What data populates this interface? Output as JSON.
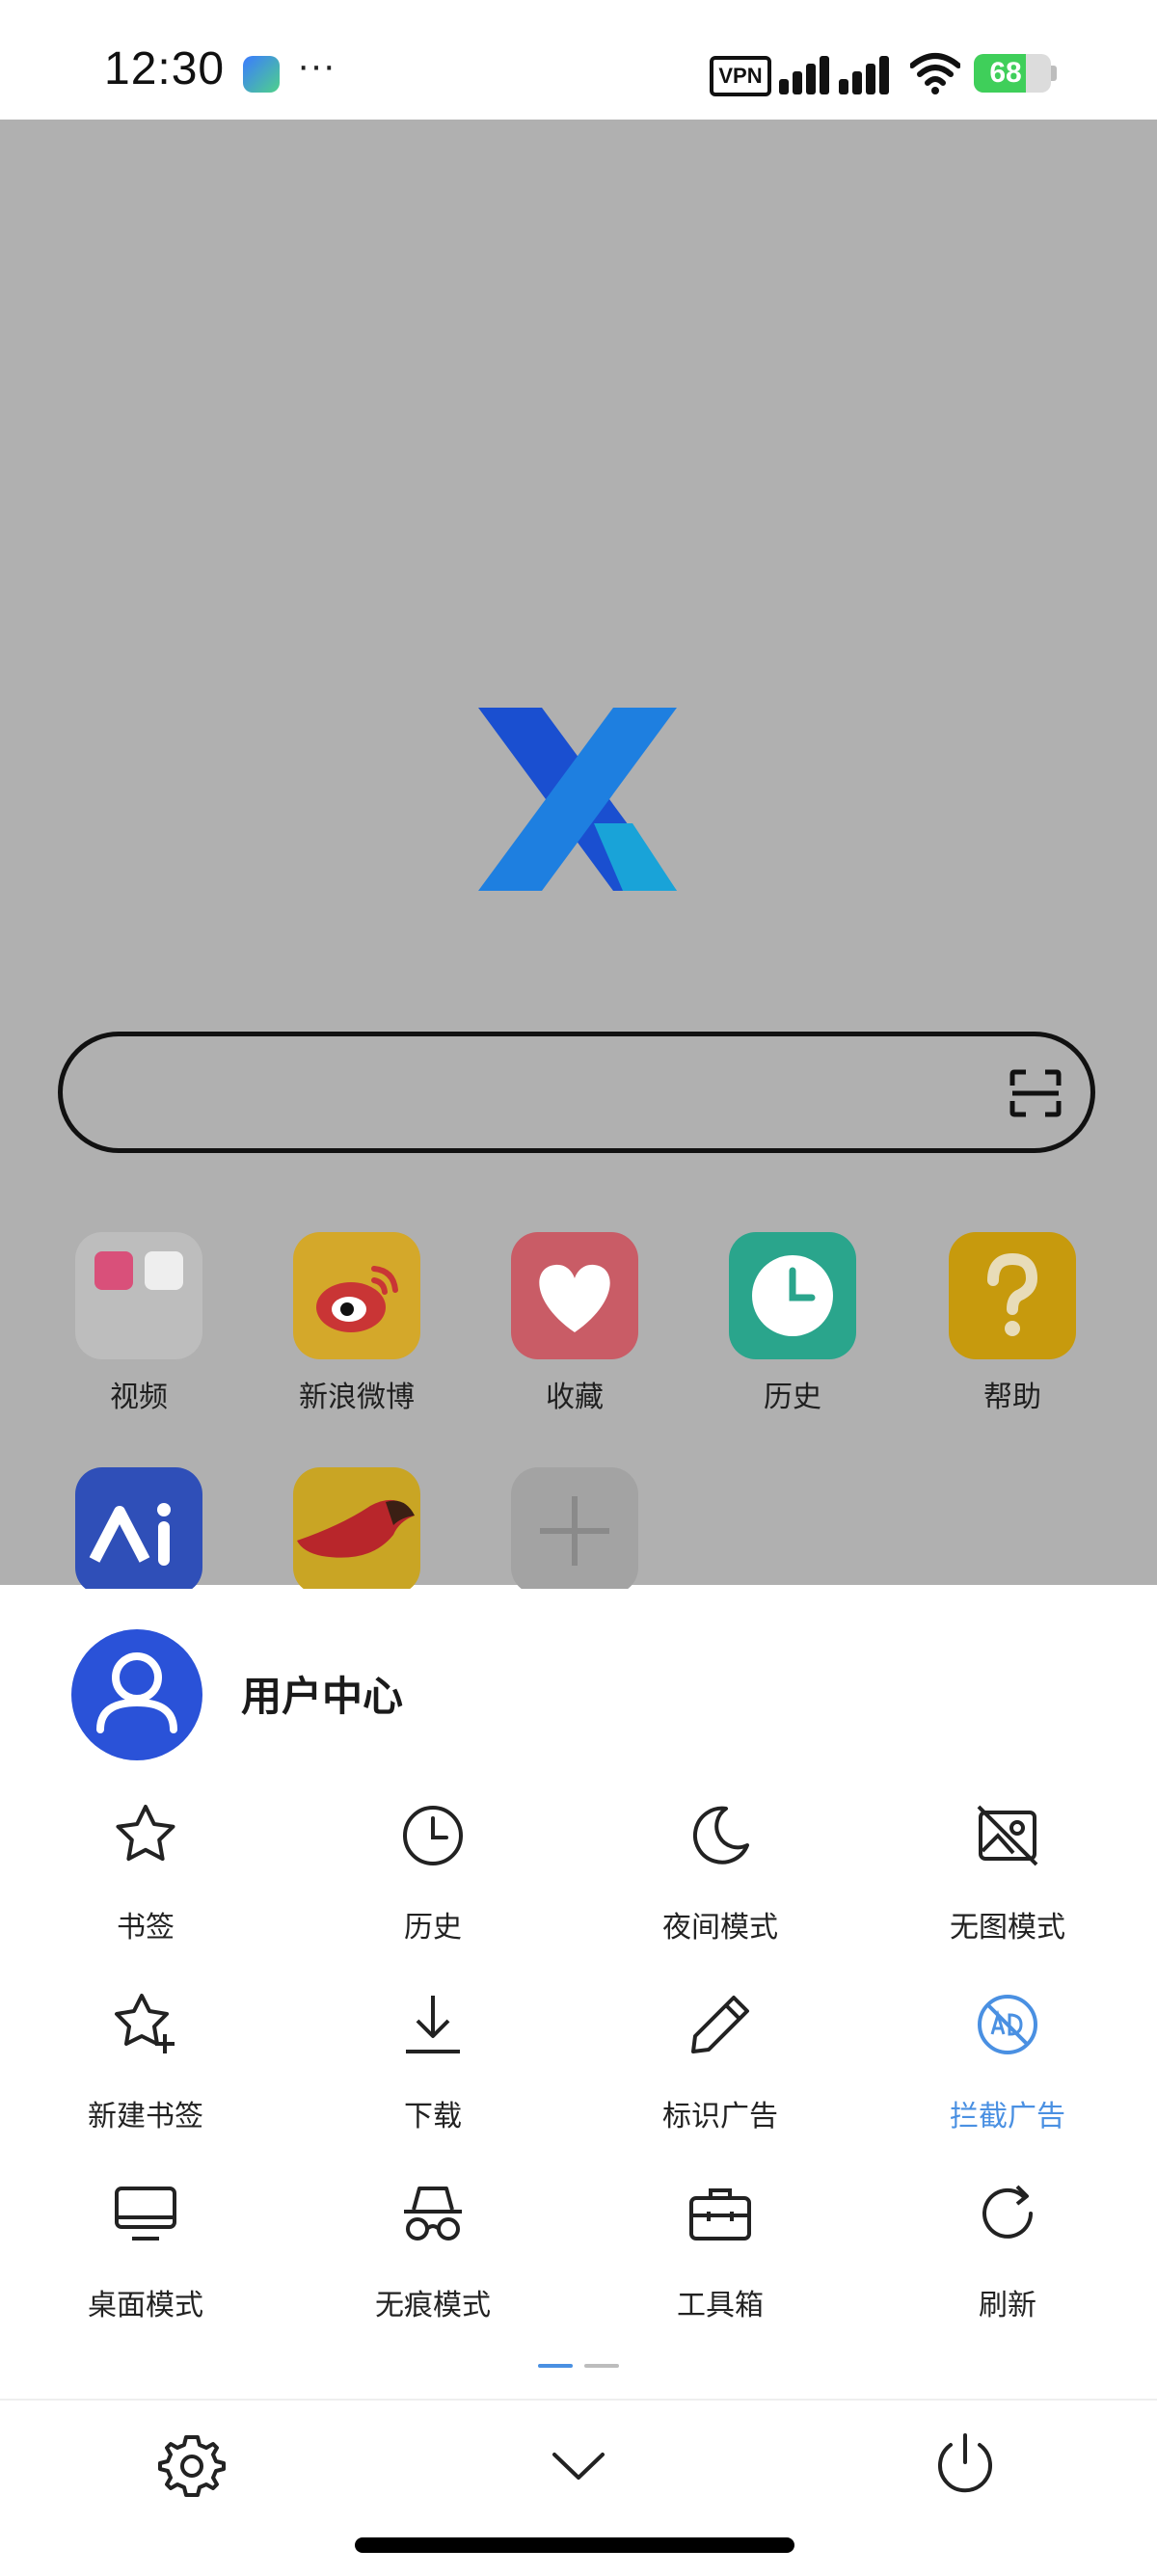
{
  "status_bar": {
    "time": "12:30",
    "more": "···",
    "vpn": "VPN",
    "battery": "68",
    "battery_level": 0.68
  },
  "colors": {
    "accent": "#4a90e2",
    "avatar_bg": "#2a52d8",
    "dim_overlay": "#b0b0b0",
    "battery_green": "#3fcf5a"
  },
  "home": {
    "logo_icon": "x-browser-logo",
    "scan_icon": "scan-icon",
    "tiles": [
      {
        "label": "视频",
        "icon": "video-folder-icon",
        "color": "#bdbdbd"
      },
      {
        "label": "新浪微博",
        "icon": "weibo-icon",
        "color": "#d4a82a"
      },
      {
        "label": "收藏",
        "icon": "heart-icon",
        "color": "#c95c66"
      },
      {
        "label": "历史",
        "icon": "clock-icon",
        "color": "#2aa58c"
      },
      {
        "label": "帮助",
        "icon": "help-icon",
        "color": "#c79a0d"
      }
    ],
    "row2_tiles": [
      {
        "icon": "ai-app-icon",
        "color": "#2f4fb8"
      },
      {
        "icon": "fox-app-icon",
        "color": "#c9a524"
      },
      {
        "icon": "add-icon",
        "color": "#a3a3a3"
      }
    ]
  },
  "menu": {
    "user_center": "用户中心",
    "items": [
      {
        "label": "书签",
        "icon": "star-icon"
      },
      {
        "label": "历史",
        "icon": "clock-icon"
      },
      {
        "label": "夜间模式",
        "icon": "moon-icon"
      },
      {
        "label": "无图模式",
        "icon": "no-image-icon"
      },
      {
        "label": "新建书签",
        "icon": "star-plus-icon"
      },
      {
        "label": "下载",
        "icon": "download-icon"
      },
      {
        "label": "标识广告",
        "icon": "pencil-icon"
      },
      {
        "label": "拦截广告",
        "icon": "ad-block-icon",
        "active": true
      },
      {
        "label": "桌面模式",
        "icon": "desktop-icon"
      },
      {
        "label": "无痕模式",
        "icon": "incognito-icon"
      },
      {
        "label": "工具箱",
        "icon": "toolbox-icon"
      },
      {
        "label": "刷新",
        "icon": "refresh-icon"
      }
    ]
  },
  "bottom_bar": {
    "settings_icon": "gear-icon",
    "collapse_icon": "chevron-down-icon",
    "power_icon": "power-icon"
  }
}
